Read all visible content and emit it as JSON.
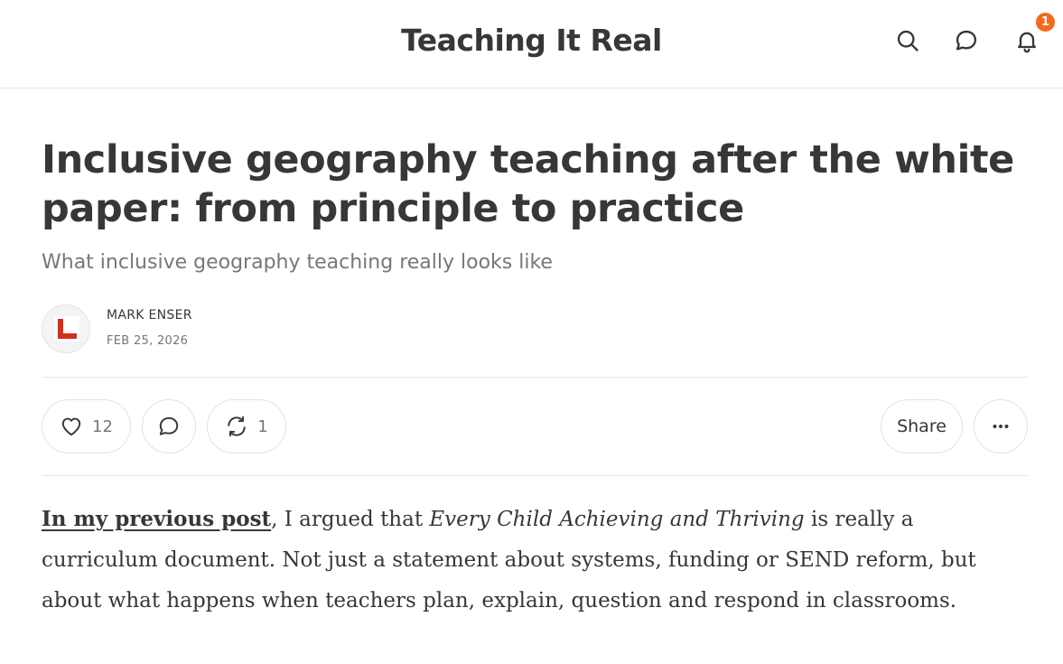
{
  "header": {
    "site_title": "Teaching It Real",
    "notification_count": "1",
    "icons": [
      "search-icon",
      "chat-icon",
      "bell-icon"
    ]
  },
  "post": {
    "title": "Inclusive geography teaching after the white paper: from principle to practice",
    "subtitle": "What inclusive geography teaching really looks like",
    "author": "MARK ENSER",
    "date": "FEB 25, 2026"
  },
  "actions": {
    "like_count": "12",
    "restack_count": "1",
    "share_label": "Share",
    "more_label": "•••"
  },
  "body": {
    "link_text": "In my previous post",
    "text_1": ", I argued that ",
    "italic_text": "Every Child Achieving and Thriving",
    "text_2": " is really a curriculum document. Not just a statement about systems, funding or SEND reform, but about what happens when teachers plan, explain, question and respond in classrooms."
  },
  "colors": {
    "text": "#363737",
    "muted": "#777777",
    "badge": "#f26a1f",
    "avatar_red": "#d62d1f",
    "divider": "#e6e6e6"
  }
}
